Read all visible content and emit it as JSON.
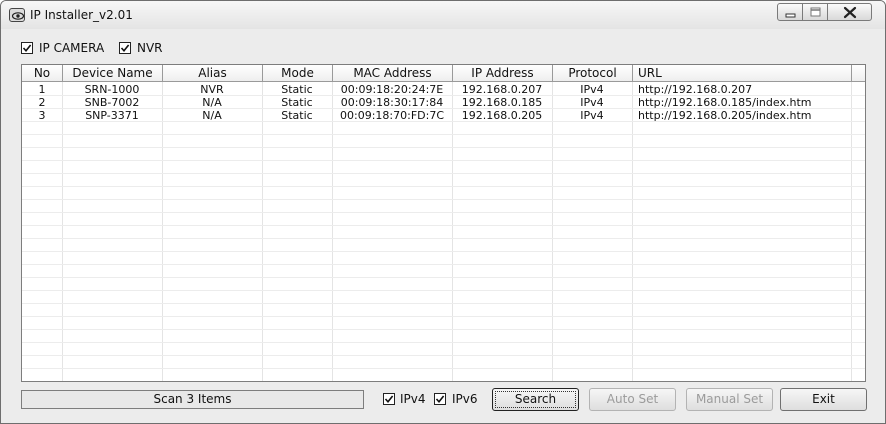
{
  "window": {
    "title": "IP Installer_v2.01"
  },
  "filters": {
    "ip_camera": {
      "label": "IP CAMERA",
      "checked": true
    },
    "nvr": {
      "label": "NVR",
      "checked": true
    }
  },
  "table": {
    "columns": [
      "No",
      "Device Name",
      "Alias",
      "Mode",
      "MAC Address",
      "IP Address",
      "Protocol",
      "URL"
    ],
    "rows": [
      [
        "1",
        "SRN-1000",
        "NVR",
        "Static",
        "00:09:18:20:24:7E",
        "192.168.0.207",
        "IPv4",
        "http://192.168.0.207"
      ],
      [
        "2",
        "SNB-7002",
        "N/A",
        "Static",
        "00:09:18:30:17:84",
        "192.168.0.185",
        "IPv4",
        "http://192.168.0.185/index.htm"
      ],
      [
        "3",
        "SNP-3371",
        "N/A",
        "Static",
        "00:09:18:70:FD:7C",
        "192.168.0.205",
        "IPv4",
        "http://192.168.0.205/index.htm"
      ]
    ]
  },
  "footer": {
    "status": "Scan 3 Items",
    "ipv4": {
      "label": "IPv4",
      "checked": true
    },
    "ipv6": {
      "label": "IPv6",
      "checked": true
    },
    "search_label": "Search",
    "auto_set_label": "Auto Set",
    "manual_set_label": "Manual Set",
    "exit_label": "Exit"
  },
  "icons": {
    "app": "eye-icon",
    "minimize": "minimize-icon",
    "maximize": "maximize-icon",
    "close": "close-icon",
    "check": "check-icon"
  }
}
